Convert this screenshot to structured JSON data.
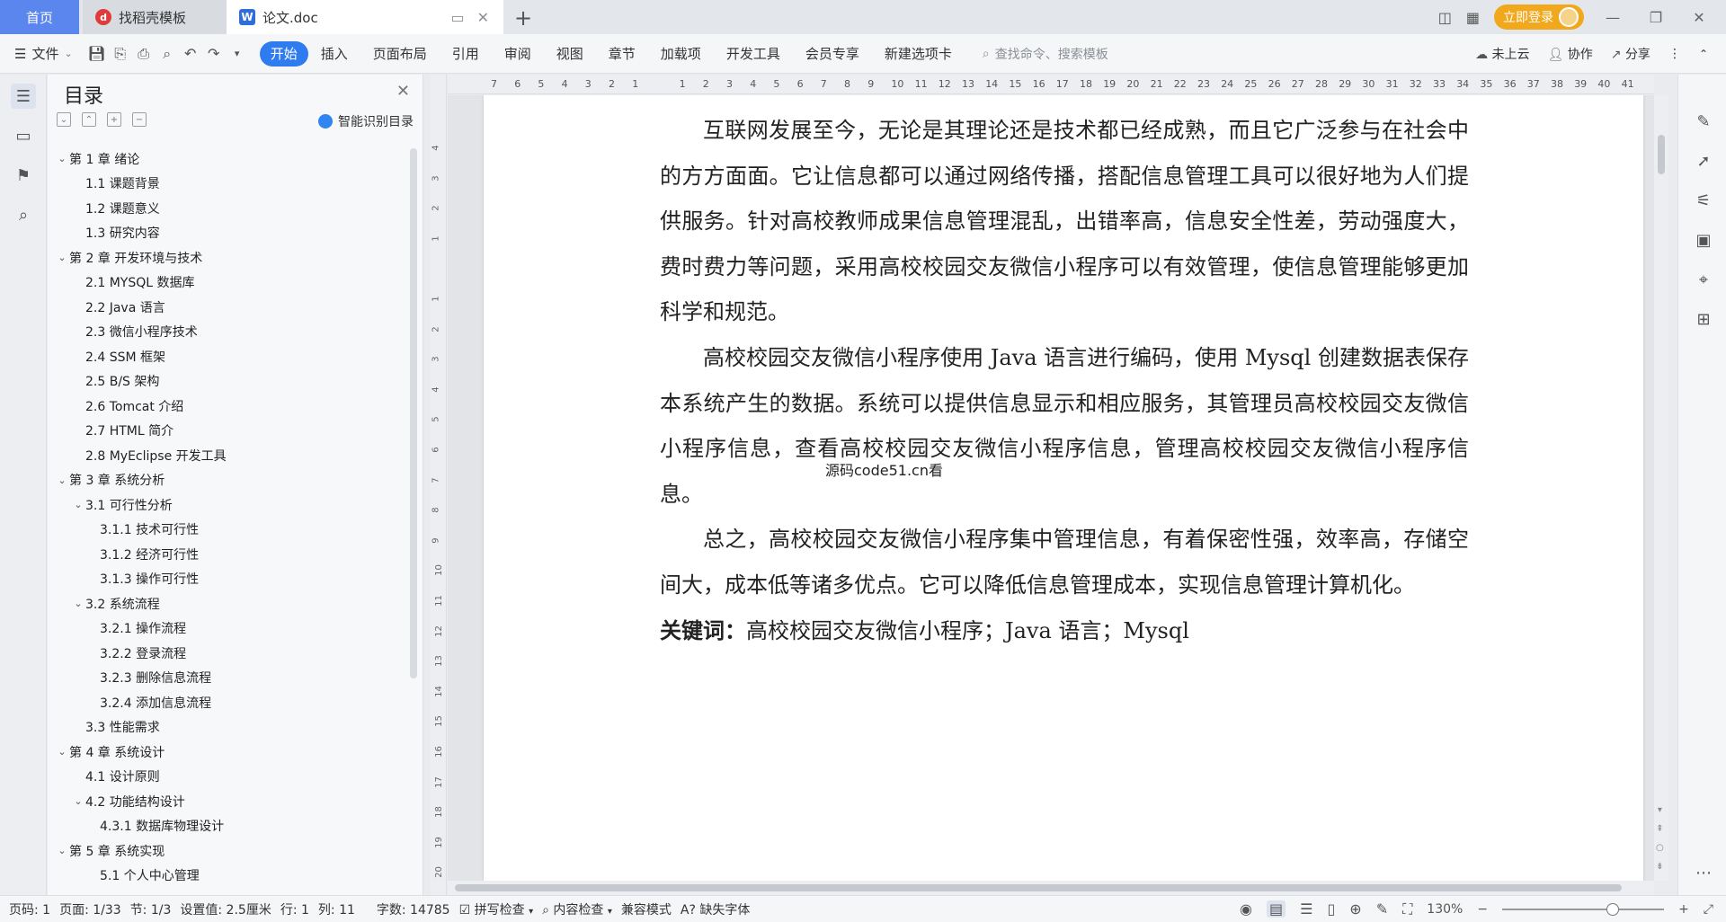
{
  "titlebar": {
    "tabs": [
      {
        "label": "首页"
      },
      {
        "label": "找稻壳模板",
        "icon": "docer-icon"
      },
      {
        "label": "论文.doc",
        "icon": "wps-writer-icon"
      }
    ],
    "login_label": "立即登录"
  },
  "toolbar": {
    "file_label": "文件",
    "ribbon_tabs": [
      "开始",
      "插入",
      "页面布局",
      "引用",
      "审阅",
      "视图",
      "章节",
      "加载项",
      "开发工具",
      "会员专享",
      "新建选项卡"
    ],
    "search_placeholder": "查找命令、搜索模板",
    "cloud_label": "未上云",
    "collab_label": "协作",
    "share_label": "分享"
  },
  "toc": {
    "title": "目录",
    "smart_label": "智能识别目录",
    "items": [
      {
        "label": "第 1 章  绪论",
        "level": 1,
        "caret": true
      },
      {
        "label": "1.1  课题背景",
        "level": 2
      },
      {
        "label": "1.2  课题意义",
        "level": 2
      },
      {
        "label": "1.3  研究内容",
        "level": 2
      },
      {
        "label": "第 2 章  开发环境与技术",
        "level": 1,
        "caret": true
      },
      {
        "label": "2.1  MYSQL 数据库",
        "level": 2
      },
      {
        "label": "2.2 Java 语言",
        "level": 2
      },
      {
        "label": "2.3  微信小程序技术",
        "level": 2
      },
      {
        "label": "2.4  SSM 框架",
        "level": 2
      },
      {
        "label": "2.5  B/S 架构",
        "level": 2
      },
      {
        "label": "2.6  Tomcat  介绍",
        "level": 2
      },
      {
        "label": "2.7  HTML 简介",
        "level": 2
      },
      {
        "label": "2.8  MyEclipse 开发工具",
        "level": 2
      },
      {
        "label": "第 3 章  系统分析",
        "level": 1,
        "caret": true
      },
      {
        "label": "3.1  可行性分析",
        "level": 2,
        "caret": true
      },
      {
        "label": "3.1.1  技术可行性",
        "level": 3
      },
      {
        "label": "3.1.2  经济可行性",
        "level": 3
      },
      {
        "label": "3.1.3  操作可行性",
        "level": 3
      },
      {
        "label": "3.2  系统流程",
        "level": 2,
        "caret": true
      },
      {
        "label": "3.2.1  操作流程",
        "level": 3
      },
      {
        "label": "3.2.2  登录流程",
        "level": 3
      },
      {
        "label": "3.2.3  删除信息流程",
        "level": 3
      },
      {
        "label": "3.2.4  添加信息流程",
        "level": 3
      },
      {
        "label": "3.3  性能需求",
        "level": 2
      },
      {
        "label": "第 4 章  系统设计",
        "level": 1,
        "caret": true
      },
      {
        "label": "4.1  设计原则",
        "level": 2
      },
      {
        "label": "4.2  功能结构设计",
        "level": 2,
        "caret": true
      },
      {
        "label": "4.3.1  数据库物理设计",
        "level": 3
      },
      {
        "label": "第 5 章  系统实现",
        "level": 1,
        "caret": true
      },
      {
        "label": "5.1 个人中心管理",
        "level": 3
      }
    ]
  },
  "ruler": {
    "h_ticks": [
      "7",
      "6",
      "5",
      "4",
      "3",
      "2",
      "1",
      "",
      "1",
      "2",
      "3",
      "4",
      "5",
      "6",
      "7",
      "8",
      "9",
      "10",
      "11",
      "12",
      "13",
      "14",
      "15",
      "16",
      "17",
      "18",
      "19",
      "20",
      "21",
      "22",
      "23",
      "24",
      "25",
      "26",
      "27",
      "28",
      "29",
      "30",
      "31",
      "32",
      "33",
      "34",
      "35",
      "36",
      "37",
      "38",
      "39",
      "40",
      "41"
    ],
    "v_ticks": [
      "4",
      "3",
      "2",
      "1",
      "",
      "1",
      "2",
      "3",
      "4",
      "5",
      "6",
      "7",
      "8",
      "9",
      "10",
      "11",
      "12",
      "13",
      "14",
      "15",
      "16",
      "17",
      "18",
      "19",
      "20"
    ]
  },
  "document": {
    "para1": "互联网发展至今，无论是其理论还是技术都已经成熟，而且它广泛参与在社会中的方方面面。它让信息都可以通过网络传播，搭配信息管理工具可以很好地为人们提供服务。针对高校教师成果信息管理混乱，出错率高，信息安全性差，劳动强度大，费时费力等问题，采用高校校园交友微信小程序可以有效管理，使信息管理能够更加科学和规范。",
    "para2": "高校校园交友微信小程序使用 Java 语言进行编码，使用 Mysql 创建数据表保存本系统产生的数据。系统可以提供信息显示和相应服务，其管理员高校校园交友微信小程序信息，查看高校校园交友微信小程序信息，管理高校校园交友微信小程序信息。",
    "para3": "总之，高校校园交友微信小程序集中管理信息，有着保密性强，效率高，存储空间大，成本低等诸多优点。它可以降低信息管理成本，实现信息管理计算机化。",
    "keywords_label": "关键词：",
    "keywords_value": "高校校园交友微信小程序；Java 语言；Mysql",
    "overlay_text": "源码code51.cn看"
  },
  "status": {
    "page_code": "页码: 1",
    "page": "页面: 1/33",
    "section": "节: 1/3",
    "setting": "设置值: 2.5厘米",
    "row": "行: 1",
    "col": "列: 11",
    "word_count": "字数: 14785",
    "spell_check": "拼写检查",
    "content_check": "内容检查",
    "compat_mode": "兼容模式",
    "missing_font": "缺失字体",
    "zoom": "130%"
  }
}
